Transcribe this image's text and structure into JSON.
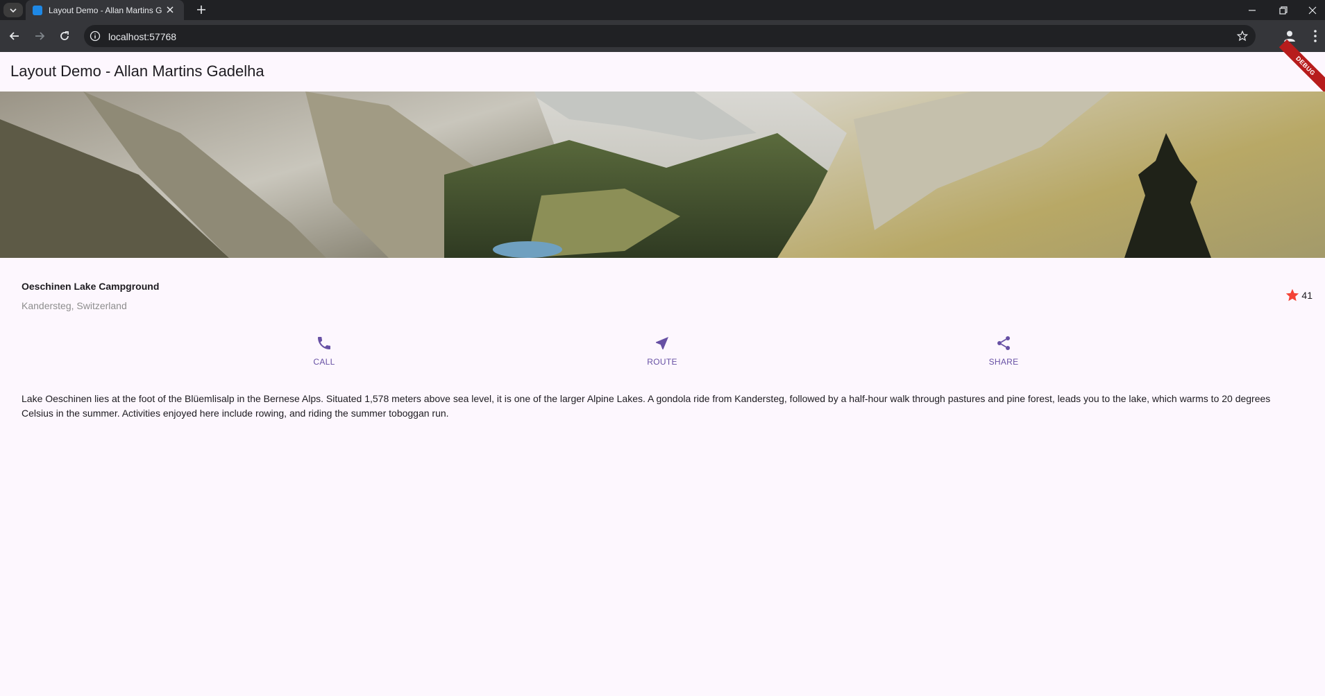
{
  "browser": {
    "tab_title": "Layout Demo - Allan Martins G",
    "url": "localhost:57768"
  },
  "app": {
    "title": "Layout Demo - Allan Martins Gadelha",
    "debug_label": "DEBUG"
  },
  "place": {
    "name": "Oeschinen Lake Campground",
    "location": "Kandersteg, Switzerland",
    "rating": "41"
  },
  "actions": [
    {
      "label": "CALL",
      "icon": "phone-icon"
    },
    {
      "label": "ROUTE",
      "icon": "navigation-icon"
    },
    {
      "label": "SHARE",
      "icon": "share-icon"
    }
  ],
  "description": "Lake Oeschinen lies at the foot of the Blüemlisalp in the Bernese Alps. Situated 1,578 meters above sea level, it is one of the larger Alpine Lakes. A gondola ride from Kandersteg, followed by a half-hour walk through pastures and pine forest, leads you to the lake, which warms to 20 degrees Celsius in the summer. Activities enjoyed here include rowing, and riding the summer toboggan run.",
  "colors": {
    "accent": "#6750a4",
    "star": "#f44336",
    "background": "#fdf7fe"
  }
}
